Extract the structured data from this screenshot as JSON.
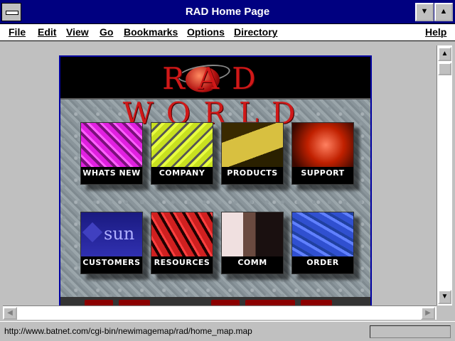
{
  "window": {
    "title": "RAD Home Page"
  },
  "menu": [
    "File",
    "Edit",
    "View",
    "Go",
    "Bookmarks",
    "Options",
    "Directory",
    "Help"
  ],
  "site": {
    "logo_text": "RAD WORLD",
    "nav": [
      {
        "label": "WHATS NEW",
        "color": "#e020e0"
      },
      {
        "label": "COMPANY",
        "color": "#c8e020"
      },
      {
        "label": "PRODUCTS",
        "color": "#c8b030"
      },
      {
        "label": "SUPPORT",
        "color": "#e04010"
      },
      {
        "label": "CUSTOMERS",
        "color": "#2020a0",
        "badge": "sun"
      },
      {
        "label": "RESOURCES",
        "color": "#d02020"
      },
      {
        "label": "COMM",
        "color": "#f0e0e0"
      },
      {
        "label": "ORDER",
        "color": "#3050d0"
      }
    ]
  },
  "status": {
    "url": "http://www.batnet.com/cgi-bin/newimagemap/rad/home_map.map"
  }
}
